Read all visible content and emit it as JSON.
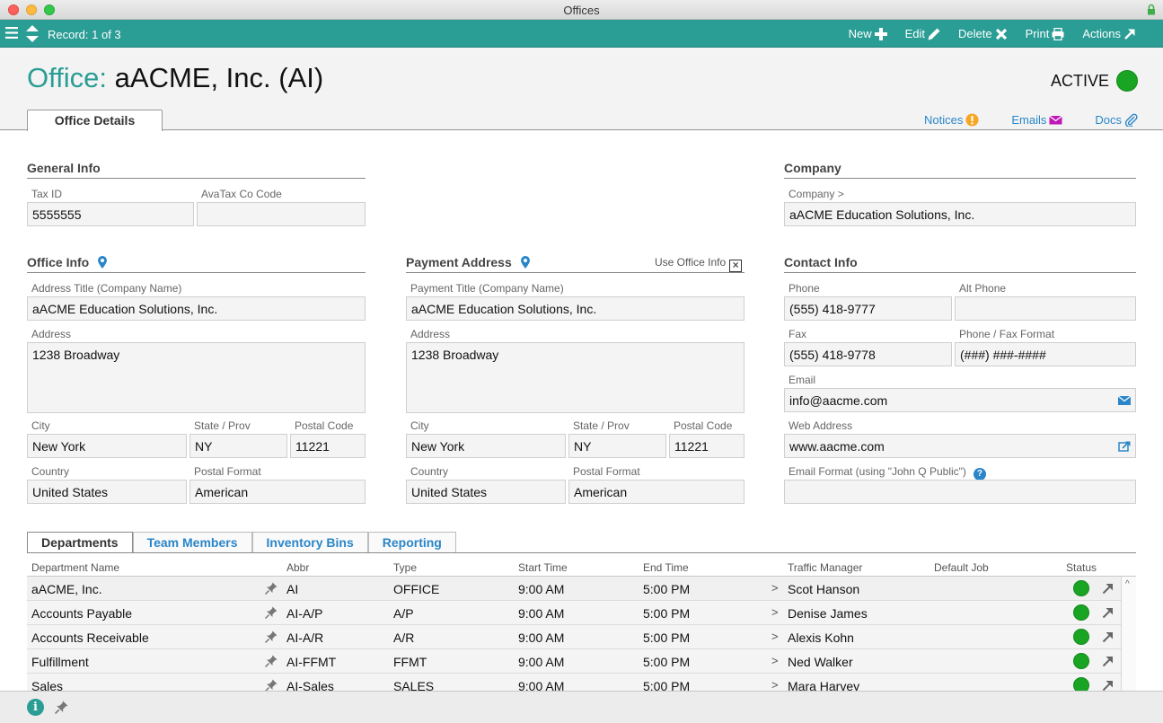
{
  "window": {
    "title": "Offices"
  },
  "toolbar": {
    "record": "Record: 1 of 3",
    "new_label": "New",
    "edit_label": "Edit",
    "delete_label": "Delete",
    "print_label": "Print",
    "actions_label": "Actions",
    "accent": "#2a9d95"
  },
  "header": {
    "label": "Office:",
    "name": "aACME, Inc.  (AI)",
    "status": "ACTIVE",
    "status_color": "#19a523",
    "tab": "Office Details",
    "links": {
      "notices": "Notices",
      "emails": "Emails",
      "docs": "Docs"
    }
  },
  "general": {
    "title": "General Info",
    "tax_id_label": "Tax ID",
    "tax_id": "5555555",
    "avatax_label": "AvaTax Co Code",
    "avatax": ""
  },
  "company": {
    "title": "Company",
    "label": "Company >",
    "value": "aACME Education Solutions, Inc."
  },
  "office_info": {
    "title": "Office Info",
    "address_title_label": "Address Title (Company Name)",
    "address_title": "aACME Education Solutions, Inc.",
    "address_label": "Address",
    "address": "1238 Broadway",
    "city_label": "City",
    "city": "New York",
    "state_label": "State / Prov",
    "state": "NY",
    "postal_label": "Postal Code",
    "postal": "11221",
    "country_label": "Country",
    "country": "United States",
    "postal_format_label": "Postal Format",
    "postal_format": "American"
  },
  "payment": {
    "title": "Payment Address",
    "use_office": "Use Office Info",
    "title_label": "Payment Title (Company Name)",
    "title_value": "aACME Education Solutions, Inc.",
    "address_label": "Address",
    "address": "1238 Broadway",
    "city_label": "City",
    "city": "New York",
    "state_label": "State / Prov",
    "state": "NY",
    "postal_label": "Postal Code",
    "postal": "11221",
    "country_label": "Country",
    "country": "United States",
    "postal_format_label": "Postal Format",
    "postal_format": "American"
  },
  "contact": {
    "title": "Contact Info",
    "phone_label": "Phone",
    "phone": "(555) 418-9777",
    "alt_phone_label": "Alt Phone",
    "alt_phone": "",
    "fax_label": "Fax",
    "fax": "(555) 418-9778",
    "format_label": "Phone / Fax Format",
    "format": "(###) ###-####",
    "email_label": "Email",
    "email": "info@aacme.com",
    "web_label": "Web Address",
    "web": "www.aacme.com",
    "email_format_label": "Email Format (using \"John Q Public\")",
    "email_format": ""
  },
  "tabs": [
    "Departments",
    "Team Members",
    "Inventory Bins",
    "Reporting"
  ],
  "departments": {
    "columns": [
      "Department Name",
      "Abbr",
      "Type",
      "Start Time",
      "End Time",
      "Traffic Manager",
      "Default Job",
      "Status"
    ],
    "rows": [
      {
        "name": "aACME, Inc.",
        "abbr": "AI",
        "type": "OFFICE",
        "start": "9:00 AM",
        "end": "5:00 PM",
        "manager": "Scot Hanson"
      },
      {
        "name": "Accounts Payable",
        "abbr": "AI-A/P",
        "type": "A/P",
        "start": "9:00 AM",
        "end": "5:00 PM",
        "manager": "Denise James"
      },
      {
        "name": "Accounts Receivable",
        "abbr": "AI-A/R",
        "type": "A/R",
        "start": "9:00 AM",
        "end": "5:00 PM",
        "manager": "Alexis Kohn"
      },
      {
        "name": "Fulfillment",
        "abbr": "AI-FFMT",
        "type": "FFMT",
        "start": "9:00 AM",
        "end": "5:00 PM",
        "manager": "Ned Walker"
      },
      {
        "name": "Sales",
        "abbr": "AI-Sales",
        "type": "SALES",
        "start": "9:00 AM",
        "end": "5:00 PM",
        "manager": "Mara Harvey"
      }
    ]
  }
}
